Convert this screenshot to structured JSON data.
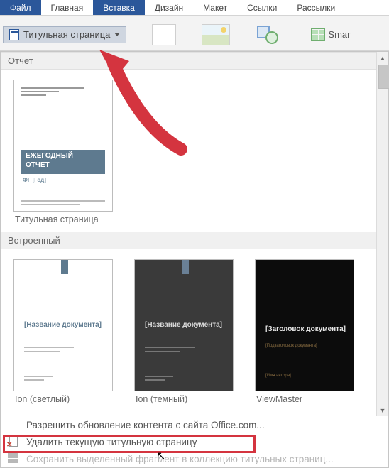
{
  "menubar": {
    "file": "Файл",
    "tabs": [
      "Главная",
      "Вставка",
      "Дизайн",
      "Макет",
      "Ссылки",
      "Рассылки"
    ],
    "active_index": 1
  },
  "ribbon": {
    "cover_page_label": "Титульная страница",
    "smart_label": "Smar"
  },
  "gallery": {
    "section1": "Отчет",
    "item1": {
      "caption": "Титульная страница",
      "band_line1": "ЕЖЕГОДНЫЙ",
      "band_line2": "ОТЧЕТ",
      "sub": "ФГ [Год]"
    },
    "section2": "Встроенный",
    "ion_light": {
      "caption": "Ion (светлый)",
      "title": "[Название документа]"
    },
    "ion_dark": {
      "caption": "Ion (темный)",
      "title": "[Название документа]"
    },
    "viewmaster": {
      "caption": "ViewMaster",
      "title": "[Заголовок документа]",
      "sub": "[Подзаголовок документа]",
      "author": "[Имя автора]"
    }
  },
  "menu": {
    "allow_update": "Разрешить обновление контента с сайта Office.com...",
    "remove_current": "Удалить текущую титульную страницу",
    "save_selection": "Сохранить выделенный фрагмент в коллекцию титульных страниц..."
  }
}
